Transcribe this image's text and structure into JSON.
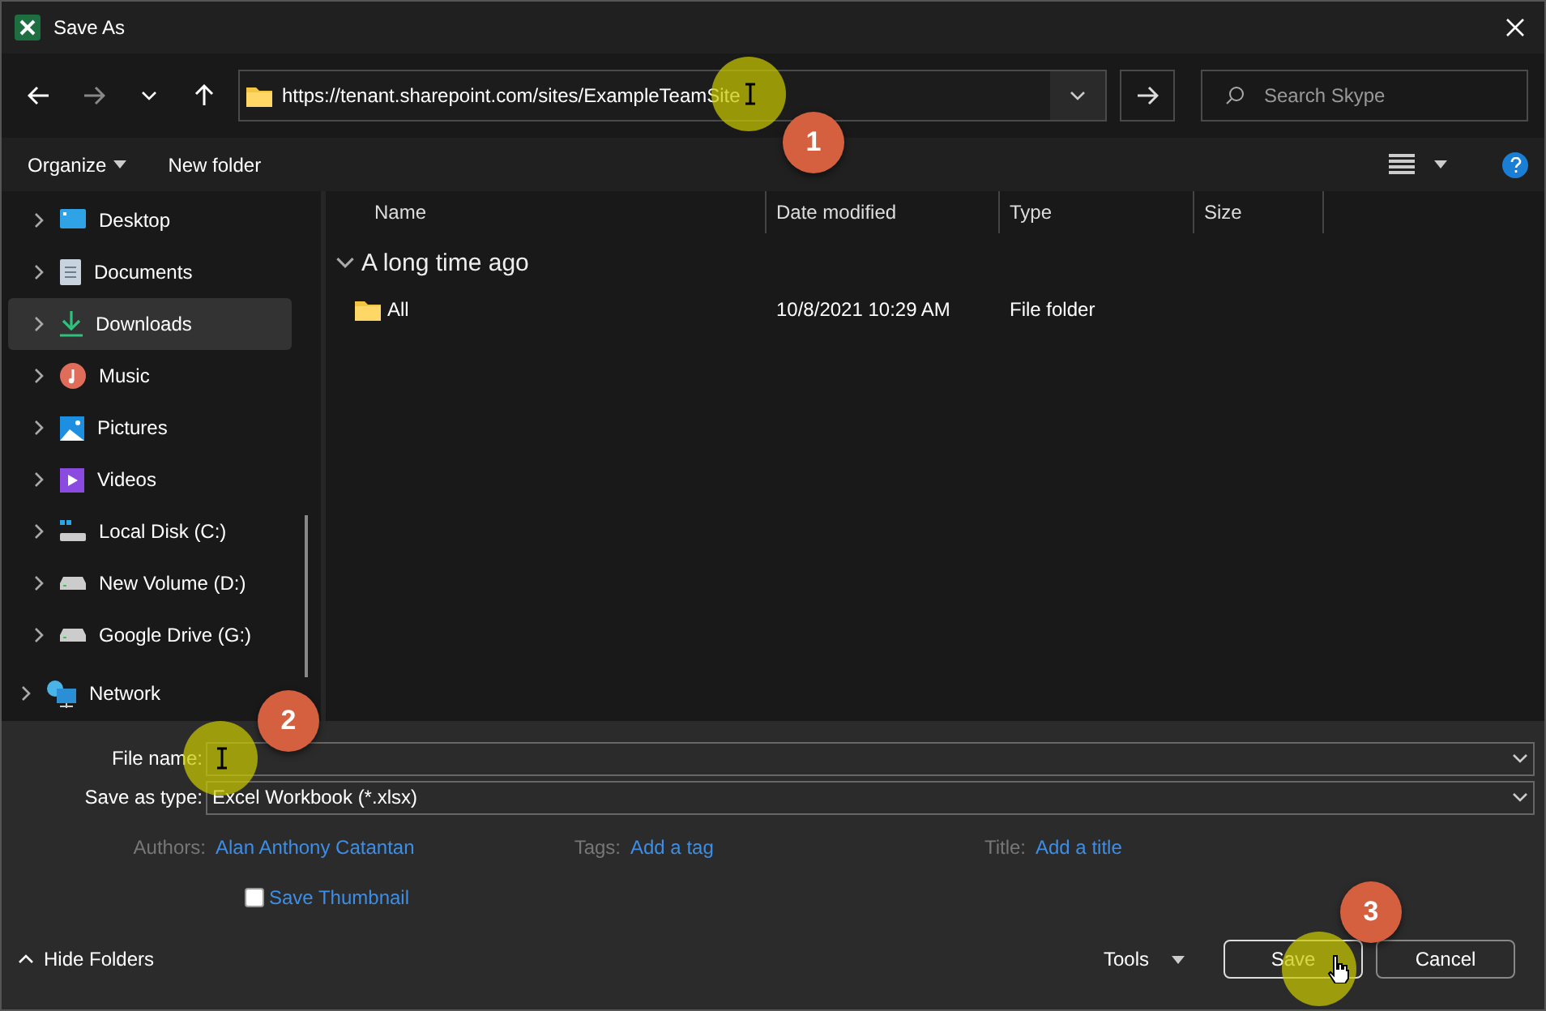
{
  "window": {
    "title": "Save As"
  },
  "address_bar": {
    "value": "https://tenant.sharepoint.com/sites/ExampleTeamSite"
  },
  "search": {
    "placeholder": "Search Skype"
  },
  "command_bar": {
    "organize": "Organize",
    "new_folder": "New folder"
  },
  "sidebar": {
    "items": [
      {
        "label": "Desktop",
        "kind": "desktop",
        "selected": false
      },
      {
        "label": "Documents",
        "kind": "documents",
        "selected": false
      },
      {
        "label": "Downloads",
        "kind": "downloads",
        "selected": true
      },
      {
        "label": "Music",
        "kind": "music",
        "selected": false
      },
      {
        "label": "Pictures",
        "kind": "pictures",
        "selected": false
      },
      {
        "label": "Videos",
        "kind": "videos",
        "selected": false
      },
      {
        "label": "Local Disk (C:)",
        "kind": "disk",
        "selected": false
      },
      {
        "label": "New Volume (D:)",
        "kind": "drive",
        "selected": false
      },
      {
        "label": "Google Drive (G:)",
        "kind": "drive",
        "selected": false
      },
      {
        "label": "Network",
        "kind": "network",
        "selected": false
      }
    ]
  },
  "table": {
    "columns": [
      "Name",
      "Date modified",
      "Type",
      "Size"
    ],
    "group": {
      "label": "A long time ago",
      "expanded": true
    },
    "rows": [
      {
        "name": "All",
        "date": "10/8/2021 10:29 AM",
        "type": "File folder"
      }
    ]
  },
  "form": {
    "file_name_label": "File name:",
    "type_label": "Save as type:",
    "type_value": "Excel Workbook (*.xlsx)",
    "authors_label": "Authors:",
    "authors": "Alan Anthony Catantan",
    "tags_label": "Tags:",
    "tags": "Add a tag",
    "title_label": "Title:",
    "title": "Add a title",
    "thumbnail": {
      "label": "Save Thumbnail",
      "checked": false
    }
  },
  "footer": {
    "hide_folders": "Hide Folders",
    "tools": "Tools",
    "save": "Save",
    "cancel": "Cancel"
  },
  "steps": [
    "1",
    "2",
    "3"
  ]
}
